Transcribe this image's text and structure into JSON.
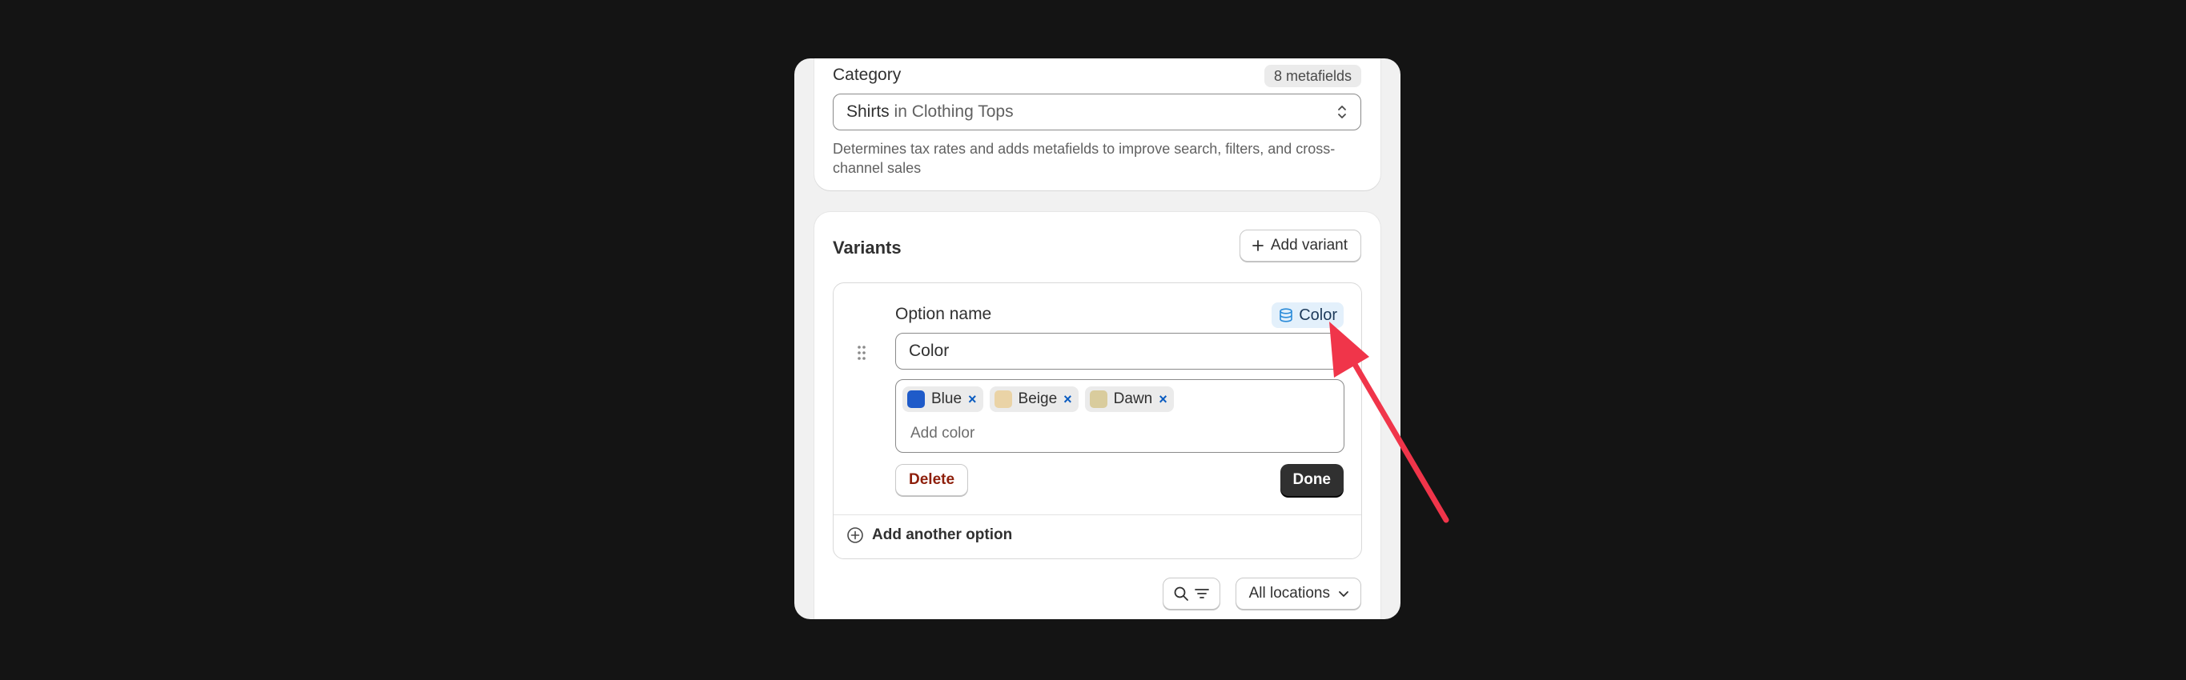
{
  "category": {
    "label": "Category",
    "metafields_badge": "8 metafields",
    "selected_value": "Shirts",
    "selected_context": " in Clothing Tops",
    "help_text": "Determines tax rates and adds metafields to improve search, filters, and cross-channel sales"
  },
  "variants": {
    "title": "Variants",
    "add_variant_label": "Add variant",
    "option": {
      "name_label": "Option name",
      "badge_label": "Color",
      "name_value": "Color",
      "values": [
        {
          "label": "Blue",
          "color": "#1f5bc9"
        },
        {
          "label": "Beige",
          "color": "#ead3a6"
        },
        {
          "label": "Dawn",
          "color": "#d9cc9d"
        }
      ],
      "value_placeholder": "Add color",
      "delete_label": "Delete",
      "done_label": "Done"
    },
    "add_option_label": "Add another option",
    "locations_label": "All locations"
  },
  "colors": {
    "annotation_arrow": "#f0354a",
    "delete_text": "#8e1f0b",
    "primary_button": "#303030"
  }
}
